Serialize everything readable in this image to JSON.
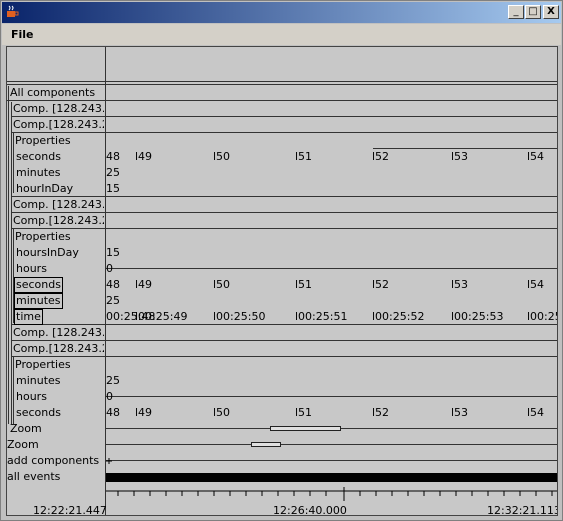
{
  "window": {
    "title": "",
    "buttons": [
      "_",
      "□",
      "X"
    ]
  },
  "menu": {
    "file": "File"
  },
  "tree": {
    "all_components": "All components",
    "comp1": "Comp. [128.243.1",
    "comp2": "Comp.[128.243.2",
    "properties": "Properties",
    "seconds": "seconds",
    "minutes": "minutes",
    "hourInDay": "hourInDay",
    "hoursInDay": "hoursInDay",
    "hours": "hours",
    "time": "time",
    "zoom": "Zoom",
    "add_components": "add components",
    "all_events": "all events"
  },
  "values": {
    "seconds_ticks": [
      "48",
      "l49",
      "l50",
      "l51",
      "l52",
      "l53",
      "l54"
    ],
    "minutes_val": "25",
    "hour_val": "15",
    "hoursInDay_val": "15",
    "hours_val": "0",
    "time_ticks": [
      "00:25:48",
      "l00:25:49",
      "l00:25:50",
      "l00:25:51",
      "l00:25:52",
      "l00:25:53",
      "l00:25"
    ],
    "time_overlap": "00:25:48"
  },
  "timeline": {
    "start": "12:22:21.447",
    "middle": "12:26:40.000",
    "end": "12:32:21.113"
  }
}
